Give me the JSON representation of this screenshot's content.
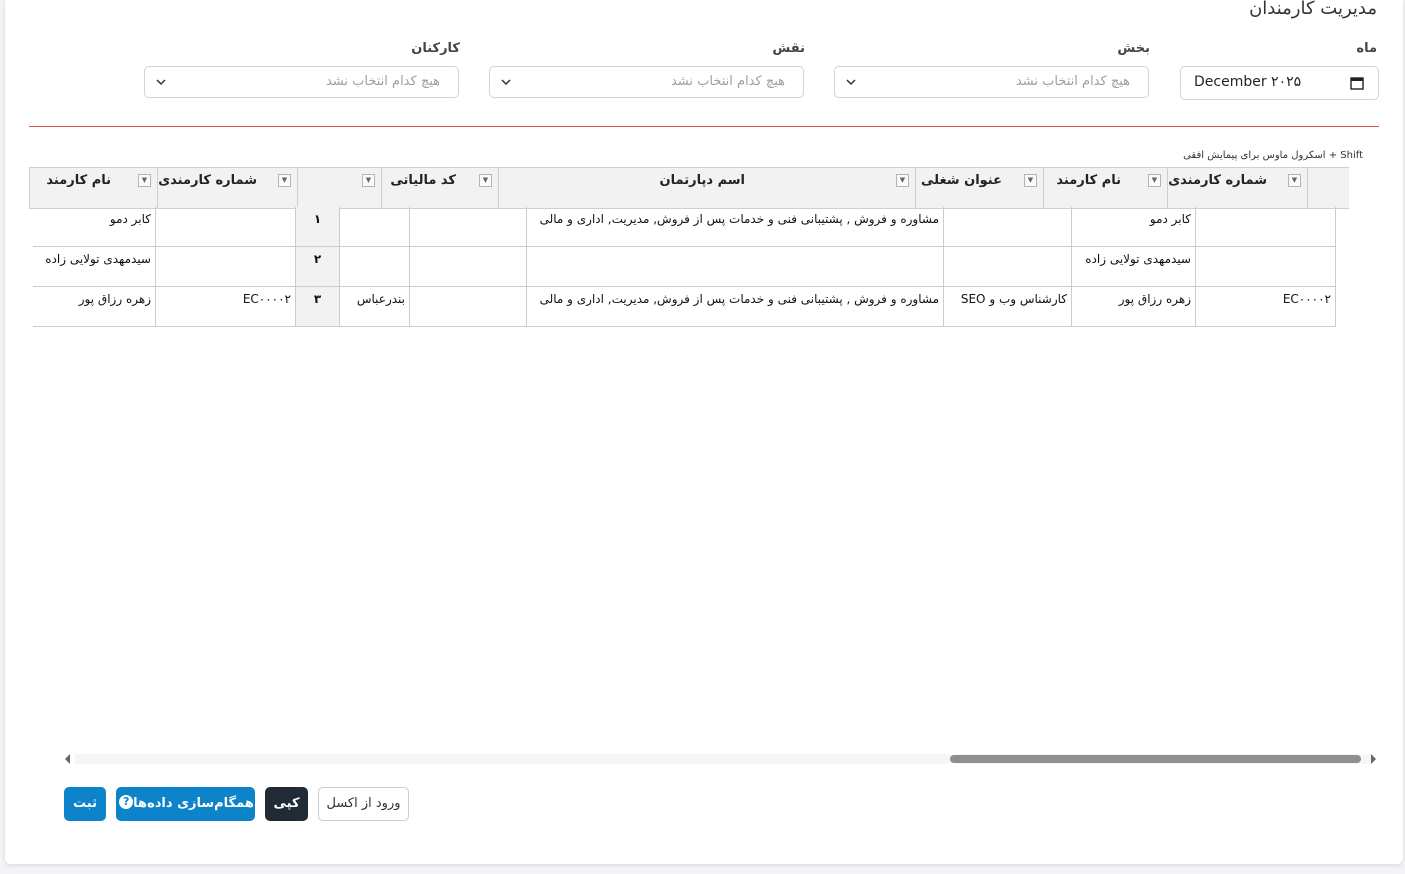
{
  "page": {
    "title": "مدیریت کارمندان"
  },
  "filters": {
    "month": {
      "label": "ماه",
      "value": "December ۲۰۲۵"
    },
    "department": {
      "label": "بخش",
      "placeholder": "هیچ کدام انتخاب نشد"
    },
    "role": {
      "label": "نقش",
      "placeholder": "هیچ کدام انتخاب نشد"
    },
    "employees": {
      "label": "کارکنان",
      "placeholder": "هیچ کدام انتخاب نشد"
    }
  },
  "grid": {
    "hint": "Shift + اسکرول ماوس برای پیمایش افقی",
    "headers": {
      "emp_no": "شماره کارمندی",
      "emp_name": "نام کارمند",
      "job_title": "عنوان شغلی",
      "department": "اسم دپارتمان",
      "tax_code": "کد مالیاتی",
      "emp_no_2": "شماره کارمندی",
      "emp_name_2": "نام کارمند"
    },
    "rows": [
      {
        "emp_no": "",
        "emp_name": "کابر دمو",
        "job_title": "",
        "department": "مشاوره و فروش , پشتیبانی فنی و خدمات پس از فروش, مدیریت, اداری و مالی",
        "tax_code": "",
        "city": "",
        "row_num": "۱",
        "emp_no_2": "",
        "emp_name_2": "کابر دمو"
      },
      {
        "emp_no": "",
        "emp_name": "سیدمهدی تولایی زاده",
        "job_title": "",
        "department": "",
        "tax_code": "",
        "city": "",
        "row_num": "۲",
        "emp_no_2": "",
        "emp_name_2": "سیدمهدی تولایی زاده"
      },
      {
        "emp_no": "EC۰۰۰۰۲",
        "emp_name": "زهره رزاق پور",
        "job_title": "کارشناس وب و SEO",
        "department": "مشاوره و فروش , پشتیبانی فنی و خدمات پس از فروش, مدیریت, اداری و مالی",
        "tax_code": "",
        "city": "بندرعباس",
        "row_num": "۳",
        "emp_no_2": "EC۰۰۰۰۲",
        "emp_name_2": "زهره رزاق پور"
      }
    ]
  },
  "actions": {
    "import_excel": "ورود از اکسل",
    "copy": "کپی",
    "sync": "همگام‌سازی داده‌ها",
    "sync_help": "?",
    "submit": "ثبت"
  },
  "icons": {
    "filter": "filter-dropdown-icon",
    "chevron": "chevron-down-icon",
    "calendar": "calendar-icon"
  },
  "colors": {
    "primary": "#0d83c9",
    "dark": "#212b36",
    "divider": "#d9534f"
  }
}
